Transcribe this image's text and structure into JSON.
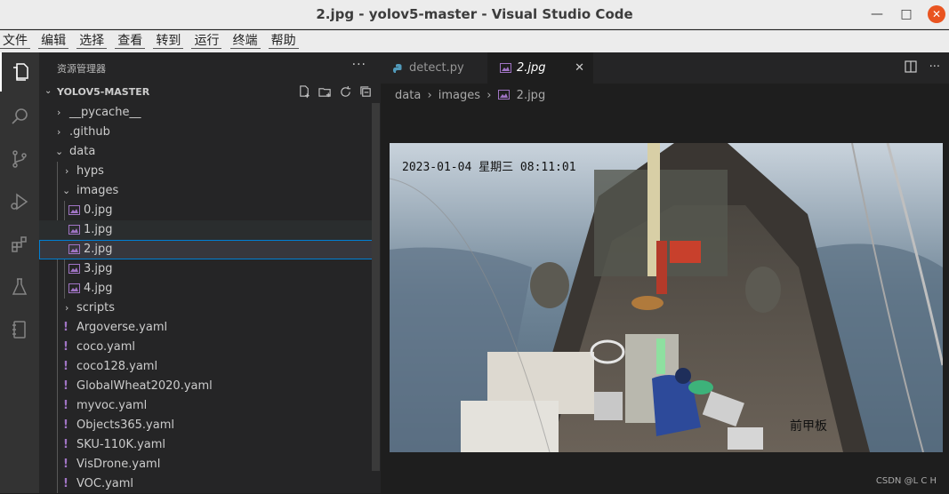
{
  "window": {
    "title": "2.jpg - yolov5-master - Visual Studio Code"
  },
  "menu": [
    "文件",
    "编辑",
    "选择",
    "查看",
    "转到",
    "运行",
    "终端",
    "帮助"
  ],
  "activity_bar": [
    "explorer-icon",
    "search-icon",
    "source-control-icon",
    "run-debug-icon",
    "extensions-icon",
    "testing-icon",
    "notebook-icon"
  ],
  "explorer": {
    "heading": "资源管理器",
    "project": "YOLOV5-MASTER",
    "tree": [
      {
        "label": "__pycache__",
        "kind": "folder",
        "expanded": false,
        "depth": 0
      },
      {
        "label": ".github",
        "kind": "folder",
        "expanded": false,
        "depth": 0
      },
      {
        "label": "data",
        "kind": "folder",
        "expanded": true,
        "depth": 0
      },
      {
        "label": "hyps",
        "kind": "folder",
        "expanded": false,
        "depth": 1
      },
      {
        "label": "images",
        "kind": "folder",
        "expanded": true,
        "depth": 1
      },
      {
        "label": "0.jpg",
        "kind": "image",
        "depth": 2
      },
      {
        "label": "1.jpg",
        "kind": "image",
        "depth": 2,
        "state": "hover"
      },
      {
        "label": "2.jpg",
        "kind": "image",
        "depth": 2,
        "state": "selected"
      },
      {
        "label": "3.jpg",
        "kind": "image",
        "depth": 2
      },
      {
        "label": "4.jpg",
        "kind": "image",
        "depth": 2
      },
      {
        "label": "scripts",
        "kind": "folder",
        "expanded": false,
        "depth": 1
      },
      {
        "label": "Argoverse.yaml",
        "kind": "yaml",
        "depth": 1
      },
      {
        "label": "coco.yaml",
        "kind": "yaml",
        "depth": 1
      },
      {
        "label": "coco128.yaml",
        "kind": "yaml",
        "depth": 1
      },
      {
        "label": "GlobalWheat2020.yaml",
        "kind": "yaml",
        "depth": 1
      },
      {
        "label": "myvoc.yaml",
        "kind": "yaml",
        "depth": 1
      },
      {
        "label": "Objects365.yaml",
        "kind": "yaml",
        "depth": 1
      },
      {
        "label": "SKU-110K.yaml",
        "kind": "yaml",
        "depth": 1
      },
      {
        "label": "VisDrone.yaml",
        "kind": "yaml",
        "depth": 1
      },
      {
        "label": "VOC.yaml",
        "kind": "yaml",
        "depth": 1
      }
    ]
  },
  "tabs": [
    {
      "label": "detect.py",
      "active": false
    },
    {
      "label": "2.jpg",
      "active": true
    }
  ],
  "breadcrumb": [
    "data",
    "images",
    "2.jpg"
  ],
  "image": {
    "timestamp": "2023-01-04 星期三 08:11:01",
    "caption": "前甲板"
  },
  "watermark": "CSDN @L C H",
  "colors": {
    "accent": "#007fd4",
    "yaml": "#a074c4",
    "python": "#519aba",
    "image": "#a074c4"
  }
}
